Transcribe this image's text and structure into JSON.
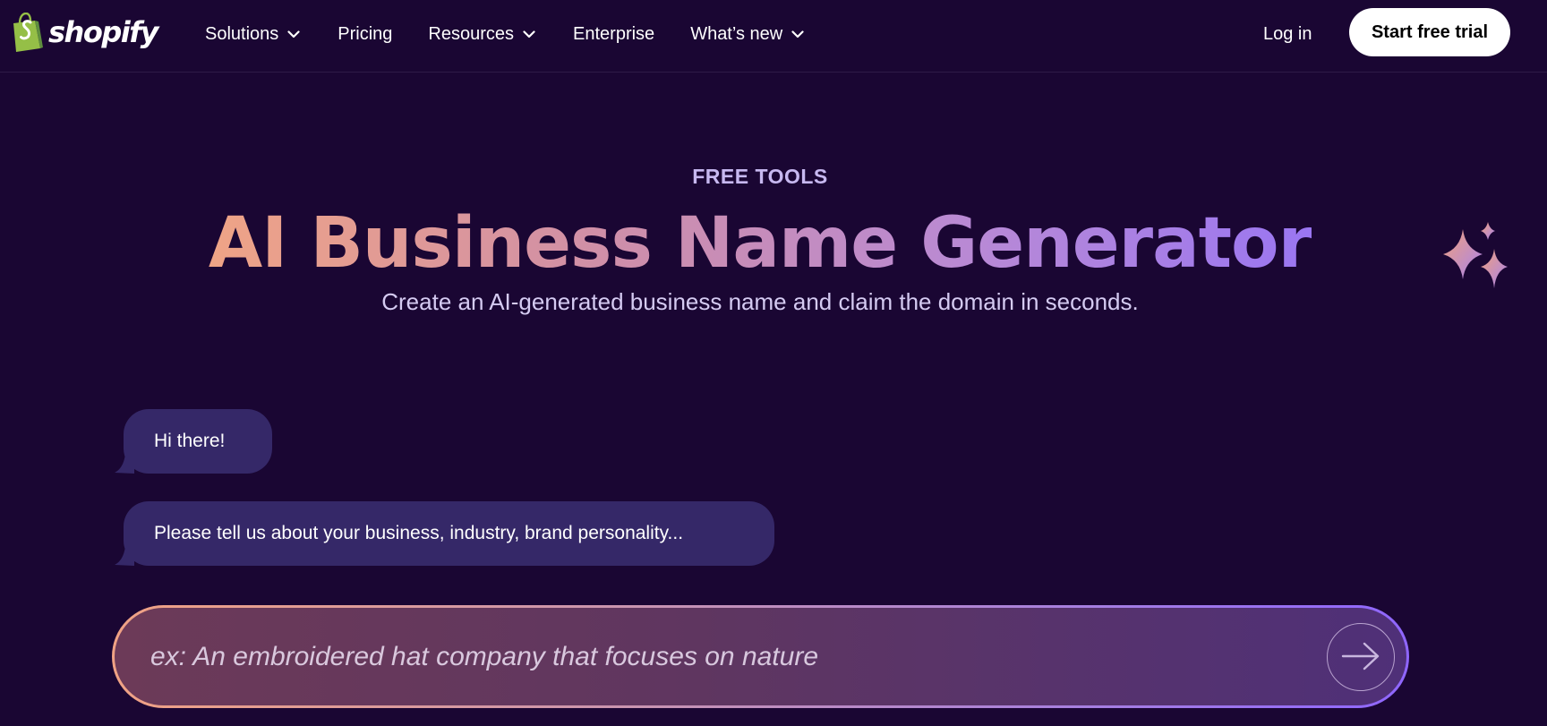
{
  "nav": {
    "logo_text": "shopify",
    "links": [
      {
        "label": "Solutions",
        "dropdown": true
      },
      {
        "label": "Pricing",
        "dropdown": false
      },
      {
        "label": "Resources",
        "dropdown": true
      },
      {
        "label": "Enterprise",
        "dropdown": false
      },
      {
        "label": "What’s new",
        "dropdown": true
      }
    ],
    "login_label": "Log in",
    "cta_label": "Start free trial"
  },
  "hero": {
    "eyebrow": "FREE TOOLS",
    "title": "AI Business Name Generator",
    "subtitle": "Create an AI-generated business name and claim the domain in seconds."
  },
  "chat": {
    "messages": [
      {
        "text": "Hi there!"
      },
      {
        "text": "Please tell us about your business, industry, brand personality..."
      }
    ],
    "input_placeholder": "ex: An embroidered hat company that focuses on nature",
    "input_value": ""
  },
  "icons": {
    "logo": "shopify-bag-icon",
    "chevron": "chevron-down-icon",
    "sparkles": "sparkles-icon",
    "send": "arrow-right-icon"
  },
  "colors": {
    "background": "#1a0633",
    "bubble": "#352868",
    "cta_bg": "#ffffff",
    "gradient_start": "#efa486",
    "gradient_end": "#9a76f2"
  }
}
